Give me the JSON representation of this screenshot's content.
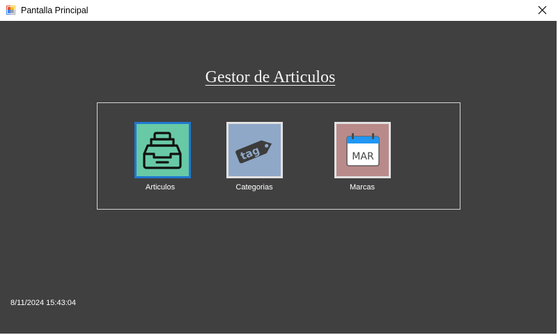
{
  "window": {
    "title": "Pantalla Principal"
  },
  "main": {
    "heading": "Gestor de Articulos",
    "tiles": [
      {
        "label": "Articulos",
        "icon": "inbox-tray-icon",
        "color": "#68c9a6"
      },
      {
        "label": "Categorias",
        "icon": "tag-icon",
        "color": "#8fa8c8",
        "icon_text": "tag"
      },
      {
        "label": "Marcas",
        "icon": "calendar-icon",
        "color": "#b98a8a",
        "icon_text": "MAR"
      }
    ]
  },
  "status": {
    "datetime": "8/11/2024 15:43:04"
  },
  "colors": {
    "background": "#404040",
    "selected_border": "#1f78d1"
  }
}
